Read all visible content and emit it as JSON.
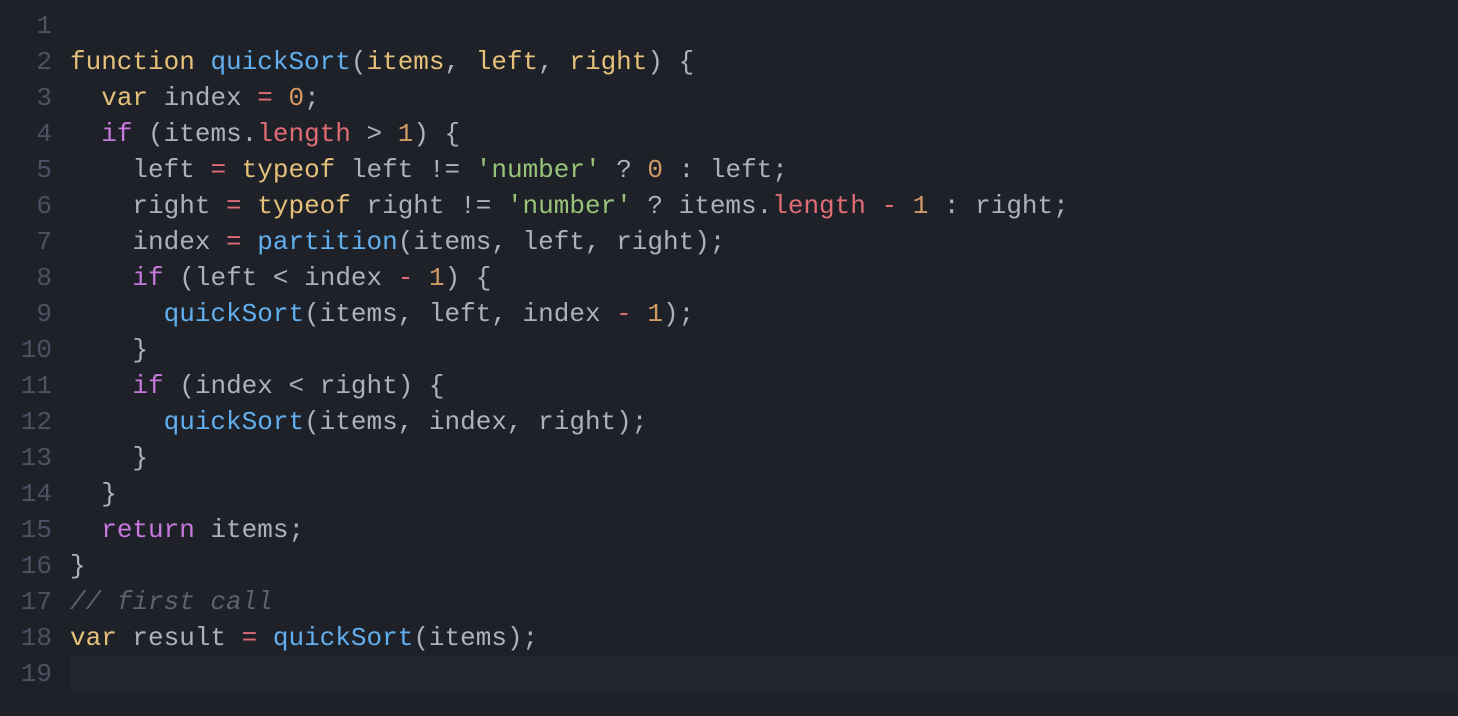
{
  "editor": {
    "language": "javascript",
    "theme": "one-dark",
    "lineNumbers": [
      "1",
      "2",
      "3",
      "4",
      "5",
      "6",
      "7",
      "8",
      "9",
      "10",
      "11",
      "12",
      "13",
      "14",
      "15",
      "16",
      "17",
      "18",
      "19"
    ],
    "cursorLine": 19,
    "lines": [
      {
        "tokens": []
      },
      {
        "tokens": [
          {
            "s": "t-key",
            "t": "function"
          },
          {
            "s": "t-pu",
            "t": " "
          },
          {
            "s": "t-fn",
            "t": "quickSort"
          },
          {
            "s": "t-pu",
            "t": "("
          },
          {
            "s": "t-pa",
            "t": "items"
          },
          {
            "s": "t-pu",
            "t": ", "
          },
          {
            "s": "t-pa",
            "t": "left"
          },
          {
            "s": "t-pu",
            "t": ", "
          },
          {
            "s": "t-pa",
            "t": "right"
          },
          {
            "s": "t-pu",
            "t": ") {"
          }
        ]
      },
      {
        "indent": "  ",
        "tokens": [
          {
            "s": "t-key",
            "t": "var"
          },
          {
            "s": "t-pu",
            "t": " "
          },
          {
            "s": "t-id",
            "t": "index"
          },
          {
            "s": "t-pu",
            "t": " "
          },
          {
            "s": "t-red",
            "t": "="
          },
          {
            "s": "t-pu",
            "t": " "
          },
          {
            "s": "t-num",
            "t": "0"
          },
          {
            "s": "t-pu",
            "t": ";"
          }
        ]
      },
      {
        "indent": "  ",
        "tokens": [
          {
            "s": "t-ctrl",
            "t": "if"
          },
          {
            "s": "t-pu",
            "t": " ("
          },
          {
            "s": "t-id",
            "t": "items"
          },
          {
            "s": "t-pu",
            "t": "."
          },
          {
            "s": "t-prop",
            "t": "length"
          },
          {
            "s": "t-pu",
            "t": " "
          },
          {
            "s": "t-op",
            "t": ">"
          },
          {
            "s": "t-pu",
            "t": " "
          },
          {
            "s": "t-num",
            "t": "1"
          },
          {
            "s": "t-pu",
            "t": ") {"
          }
        ]
      },
      {
        "indent": "    ",
        "tokens": [
          {
            "s": "t-id",
            "t": "left"
          },
          {
            "s": "t-pu",
            "t": " "
          },
          {
            "s": "t-red",
            "t": "="
          },
          {
            "s": "t-pu",
            "t": " "
          },
          {
            "s": "t-key",
            "t": "typeof"
          },
          {
            "s": "t-pu",
            "t": " "
          },
          {
            "s": "t-id",
            "t": "left"
          },
          {
            "s": "t-pu",
            "t": " "
          },
          {
            "s": "t-op",
            "t": "!="
          },
          {
            "s": "t-pu",
            "t": " "
          },
          {
            "s": "t-str",
            "t": "'number'"
          },
          {
            "s": "t-pu",
            "t": " "
          },
          {
            "s": "t-op",
            "t": "?"
          },
          {
            "s": "t-pu",
            "t": " "
          },
          {
            "s": "t-num",
            "t": "0"
          },
          {
            "s": "t-pu",
            "t": " "
          },
          {
            "s": "t-op",
            "t": ":"
          },
          {
            "s": "t-pu",
            "t": " "
          },
          {
            "s": "t-id",
            "t": "left"
          },
          {
            "s": "t-pu",
            "t": ";"
          }
        ]
      },
      {
        "indent": "    ",
        "tokens": [
          {
            "s": "t-id",
            "t": "right"
          },
          {
            "s": "t-pu",
            "t": " "
          },
          {
            "s": "t-red",
            "t": "="
          },
          {
            "s": "t-pu",
            "t": " "
          },
          {
            "s": "t-key",
            "t": "typeof"
          },
          {
            "s": "t-pu",
            "t": " "
          },
          {
            "s": "t-id",
            "t": "right"
          },
          {
            "s": "t-pu",
            "t": " "
          },
          {
            "s": "t-op",
            "t": "!="
          },
          {
            "s": "t-pu",
            "t": " "
          },
          {
            "s": "t-str",
            "t": "'number'"
          },
          {
            "s": "t-pu",
            "t": " "
          },
          {
            "s": "t-op",
            "t": "?"
          },
          {
            "s": "t-pu",
            "t": " "
          },
          {
            "s": "t-id",
            "t": "items"
          },
          {
            "s": "t-pu",
            "t": "."
          },
          {
            "s": "t-prop",
            "t": "length"
          },
          {
            "s": "t-pu",
            "t": " "
          },
          {
            "s": "t-red",
            "t": "-"
          },
          {
            "s": "t-pu",
            "t": " "
          },
          {
            "s": "t-num",
            "t": "1"
          },
          {
            "s": "t-pu",
            "t": " "
          },
          {
            "s": "t-op",
            "t": ":"
          },
          {
            "s": "t-pu",
            "t": " "
          },
          {
            "s": "t-id",
            "t": "right"
          },
          {
            "s": "t-pu",
            "t": ";"
          }
        ]
      },
      {
        "indent": "    ",
        "tokens": [
          {
            "s": "t-id",
            "t": "index"
          },
          {
            "s": "t-pu",
            "t": " "
          },
          {
            "s": "t-red",
            "t": "="
          },
          {
            "s": "t-pu",
            "t": " "
          },
          {
            "s": "t-fn",
            "t": "partition"
          },
          {
            "s": "t-pu",
            "t": "("
          },
          {
            "s": "t-id",
            "t": "items"
          },
          {
            "s": "t-pu",
            "t": ", "
          },
          {
            "s": "t-id",
            "t": "left"
          },
          {
            "s": "t-pu",
            "t": ", "
          },
          {
            "s": "t-id",
            "t": "right"
          },
          {
            "s": "t-pu",
            "t": ");"
          }
        ]
      },
      {
        "indent": "    ",
        "tokens": [
          {
            "s": "t-ctrl",
            "t": "if"
          },
          {
            "s": "t-pu",
            "t": " ("
          },
          {
            "s": "t-id",
            "t": "left"
          },
          {
            "s": "t-pu",
            "t": " "
          },
          {
            "s": "t-op",
            "t": "<"
          },
          {
            "s": "t-pu",
            "t": " "
          },
          {
            "s": "t-id",
            "t": "index"
          },
          {
            "s": "t-pu",
            "t": " "
          },
          {
            "s": "t-red",
            "t": "-"
          },
          {
            "s": "t-pu",
            "t": " "
          },
          {
            "s": "t-num",
            "t": "1"
          },
          {
            "s": "t-pu",
            "t": ") {"
          }
        ]
      },
      {
        "indent": "      ",
        "tokens": [
          {
            "s": "t-fn",
            "t": "quickSort"
          },
          {
            "s": "t-pu",
            "t": "("
          },
          {
            "s": "t-id",
            "t": "items"
          },
          {
            "s": "t-pu",
            "t": ", "
          },
          {
            "s": "t-id",
            "t": "left"
          },
          {
            "s": "t-pu",
            "t": ", "
          },
          {
            "s": "t-id",
            "t": "index"
          },
          {
            "s": "t-pu",
            "t": " "
          },
          {
            "s": "t-red",
            "t": "-"
          },
          {
            "s": "t-pu",
            "t": " "
          },
          {
            "s": "t-num",
            "t": "1"
          },
          {
            "s": "t-pu",
            "t": ");"
          }
        ]
      },
      {
        "indent": "    ",
        "tokens": [
          {
            "s": "t-pu",
            "t": "}"
          }
        ]
      },
      {
        "indent": "    ",
        "tokens": [
          {
            "s": "t-ctrl",
            "t": "if"
          },
          {
            "s": "t-pu",
            "t": " ("
          },
          {
            "s": "t-id",
            "t": "index"
          },
          {
            "s": "t-pu",
            "t": " "
          },
          {
            "s": "t-op",
            "t": "<"
          },
          {
            "s": "t-pu",
            "t": " "
          },
          {
            "s": "t-id",
            "t": "right"
          },
          {
            "s": "t-pu",
            "t": ") {"
          }
        ]
      },
      {
        "indent": "      ",
        "tokens": [
          {
            "s": "t-fn",
            "t": "quickSort"
          },
          {
            "s": "t-pu",
            "t": "("
          },
          {
            "s": "t-id",
            "t": "items"
          },
          {
            "s": "t-pu",
            "t": ", "
          },
          {
            "s": "t-id",
            "t": "index"
          },
          {
            "s": "t-pu",
            "t": ", "
          },
          {
            "s": "t-id",
            "t": "right"
          },
          {
            "s": "t-pu",
            "t": ");"
          }
        ]
      },
      {
        "indent": "    ",
        "tokens": [
          {
            "s": "t-pu",
            "t": "}"
          }
        ]
      },
      {
        "indent": "  ",
        "tokens": [
          {
            "s": "t-pu",
            "t": "}"
          }
        ]
      },
      {
        "indent": "  ",
        "tokens": [
          {
            "s": "t-ctrl",
            "t": "return"
          },
          {
            "s": "t-pu",
            "t": " "
          },
          {
            "s": "t-id",
            "t": "items"
          },
          {
            "s": "t-pu",
            "t": ";"
          }
        ]
      },
      {
        "tokens": [
          {
            "s": "t-pu",
            "t": "}"
          }
        ]
      },
      {
        "tokens": [
          {
            "s": "t-cmt",
            "t": "// first call"
          }
        ]
      },
      {
        "tokens": [
          {
            "s": "t-key",
            "t": "var"
          },
          {
            "s": "t-pu",
            "t": " "
          },
          {
            "s": "t-id",
            "t": "result"
          },
          {
            "s": "t-pu",
            "t": " "
          },
          {
            "s": "t-red",
            "t": "="
          },
          {
            "s": "t-pu",
            "t": " "
          },
          {
            "s": "t-fn",
            "t": "quickSort"
          },
          {
            "s": "t-pu",
            "t": "("
          },
          {
            "s": "t-id",
            "t": "items"
          },
          {
            "s": "t-pu",
            "t": ");"
          }
        ]
      },
      {
        "tokens": []
      }
    ]
  },
  "colors": {
    "background": "#1e2127",
    "foreground": "#abb2bf",
    "gutter": "#4b5263",
    "keyword": "#E5C07B",
    "control": "#C678DD",
    "function": "#61AFEF",
    "string": "#98C379",
    "number": "#D19A66",
    "property": "#E06C75",
    "comment": "#5c6370"
  }
}
